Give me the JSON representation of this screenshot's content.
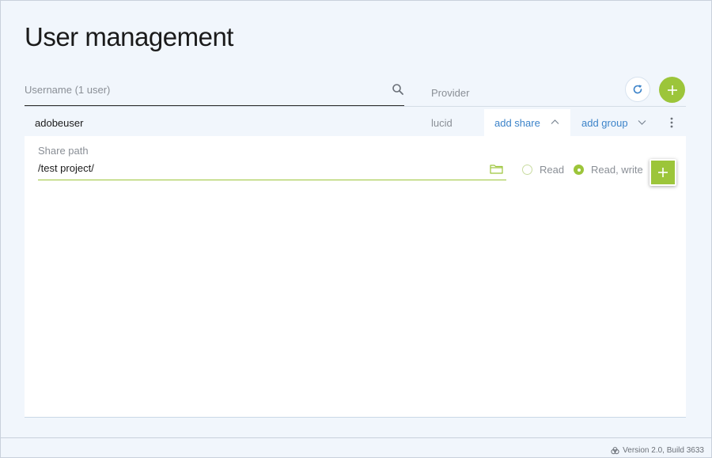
{
  "header": {
    "title": "User management"
  },
  "search": {
    "placeholder": "Username (1 user)",
    "value": ""
  },
  "columns": {
    "provider": "Provider"
  },
  "user": {
    "name": "adobeuser",
    "provider": "lucid",
    "add_share_label": "add share",
    "add_group_label": "add group"
  },
  "share_form": {
    "path_label": "Share path",
    "path_value": "/test project/",
    "read_label": "Read",
    "read_write_label": "Read, write",
    "selected_permission": "Read, write"
  },
  "footer": {
    "version": "Version 2.0, Build 3633"
  },
  "colors": {
    "accent_green": "#9cc53a",
    "link_blue": "#3c83c9",
    "background": "#f1f6fc"
  }
}
